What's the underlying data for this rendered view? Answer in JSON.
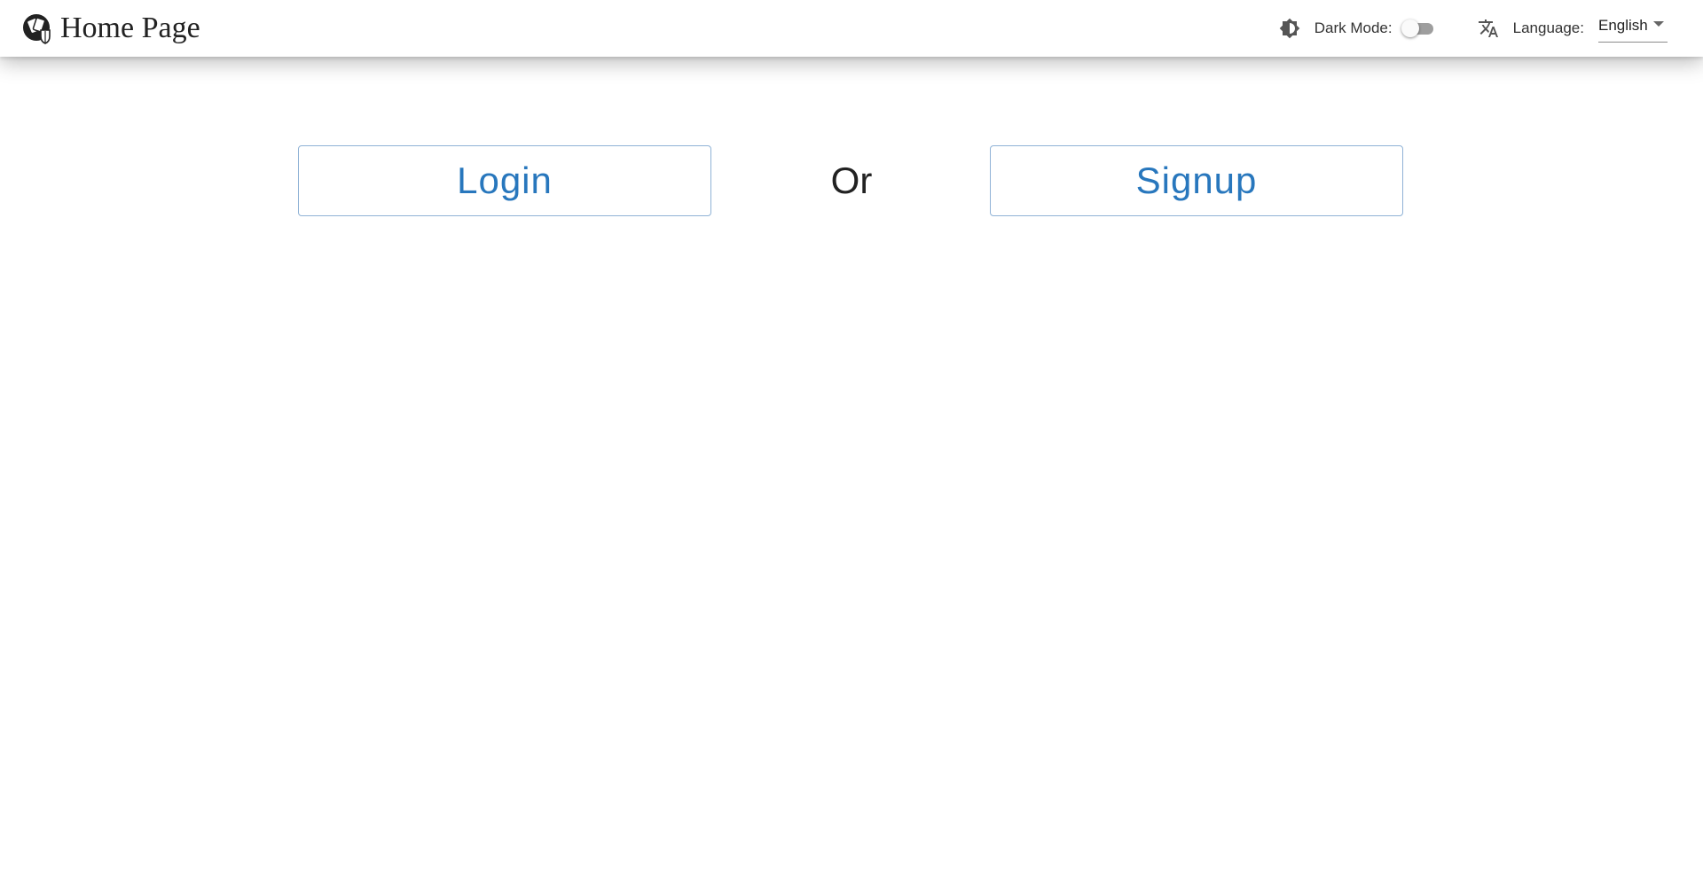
{
  "header": {
    "title": "Home Page",
    "logo_icon": "cards-on-circle-icon",
    "dark_mode": {
      "icon": "brightness-icon",
      "label": "Dark Mode:",
      "enabled": false
    },
    "language": {
      "icon": "translate-icon",
      "label": "Language:",
      "selected": "English"
    }
  },
  "main": {
    "login_label": "Login",
    "separator_text": "Or",
    "signup_label": "Signup"
  },
  "colors": {
    "accent": "#2877bd",
    "button_border": "#8fb2d6",
    "switch_track": "#9e9e9e"
  }
}
